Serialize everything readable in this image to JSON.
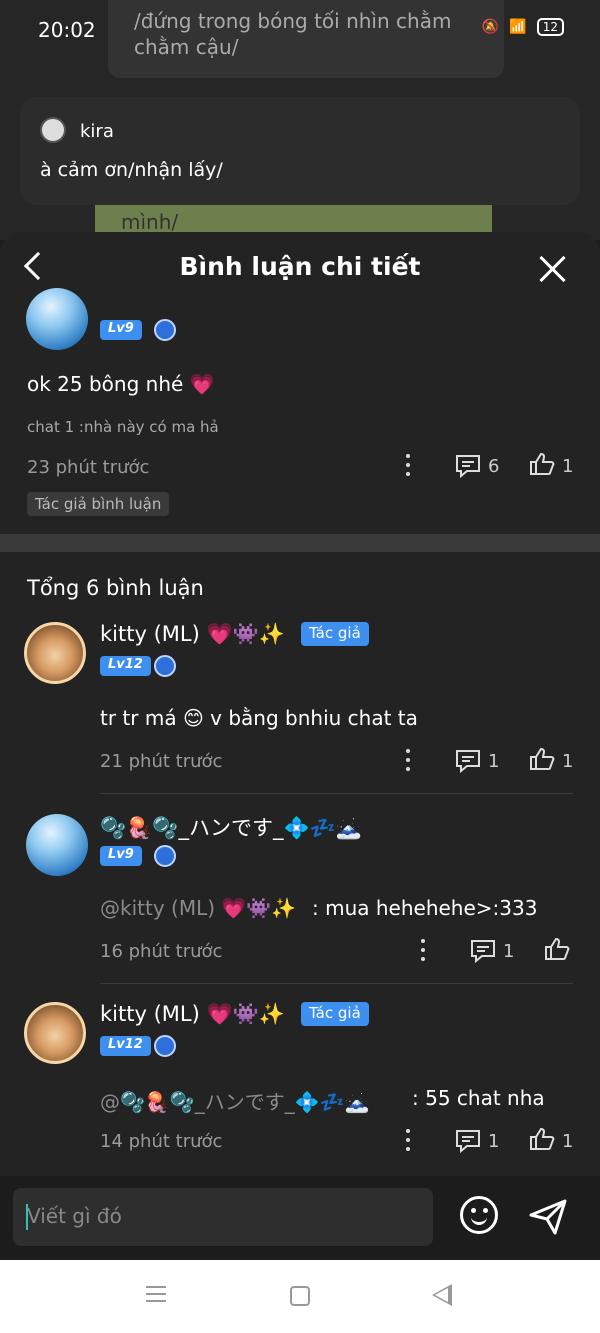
{
  "status_bar": {
    "time": "20:02",
    "battery": "12"
  },
  "background_chat": {
    "top_bubble_text": "/đứng trong bóng tối nhìn chằm chằm cậu/",
    "green_bubble_text": "mình/",
    "kira": {
      "name": "kira",
      "message": "à cảm ơn/nhận lấy/"
    }
  },
  "sheet": {
    "title": "Bình luận chi tiết",
    "main_comment": {
      "level": "Lv9",
      "content": "ok 25 bông nhé 💗",
      "context": "chat 1 :nhà này có ma hả",
      "time": "23 phút trước",
      "reply_count": "6",
      "like_count": "1",
      "author_tag": "Tác giả bình luận"
    },
    "total_label": "Tổng 6 bình luận",
    "replies": [
      {
        "name": "kitty (ML) 💗👾✨",
        "author_tag": "Tác giả",
        "level": "Lv12",
        "content": "tr tr má 😊 v bằng bnhiu chat ta",
        "mention": "",
        "time": "21 phút trước",
        "reply_count": "1",
        "like_count": "1"
      },
      {
        "name": "🫧🪼🫧_ハンです_💠💤🗻",
        "author_tag": "",
        "level": "Lv9",
        "content": ": mua hehehehe>:333",
        "mention": "@kitty (ML) 💗👾✨",
        "time": "16 phút trước",
        "reply_count": "1",
        "like_count": ""
      },
      {
        "name": "kitty (ML) 💗👾✨",
        "author_tag": "Tác giả",
        "level": "Lv12",
        "content": ": 55 chat nha",
        "mention": "@🫧🪼🫧_ハンです_💠💤🗻",
        "time": "14 phút trước",
        "reply_count": "1",
        "like_count": "1"
      }
    ]
  },
  "input": {
    "placeholder": "Viết gì đó"
  },
  "icons": {
    "back": "back-chevron-icon",
    "close": "close-icon",
    "more": "more-vertical-icon",
    "comment": "comment-icon",
    "like": "thumbs-up-icon",
    "emoji": "emoji-icon",
    "send": "send-icon"
  },
  "colors": {
    "accent": "#3d8ff0",
    "sheet_bg": "#232323",
    "text": "#ffffff",
    "muted": "#9a9a9a"
  }
}
